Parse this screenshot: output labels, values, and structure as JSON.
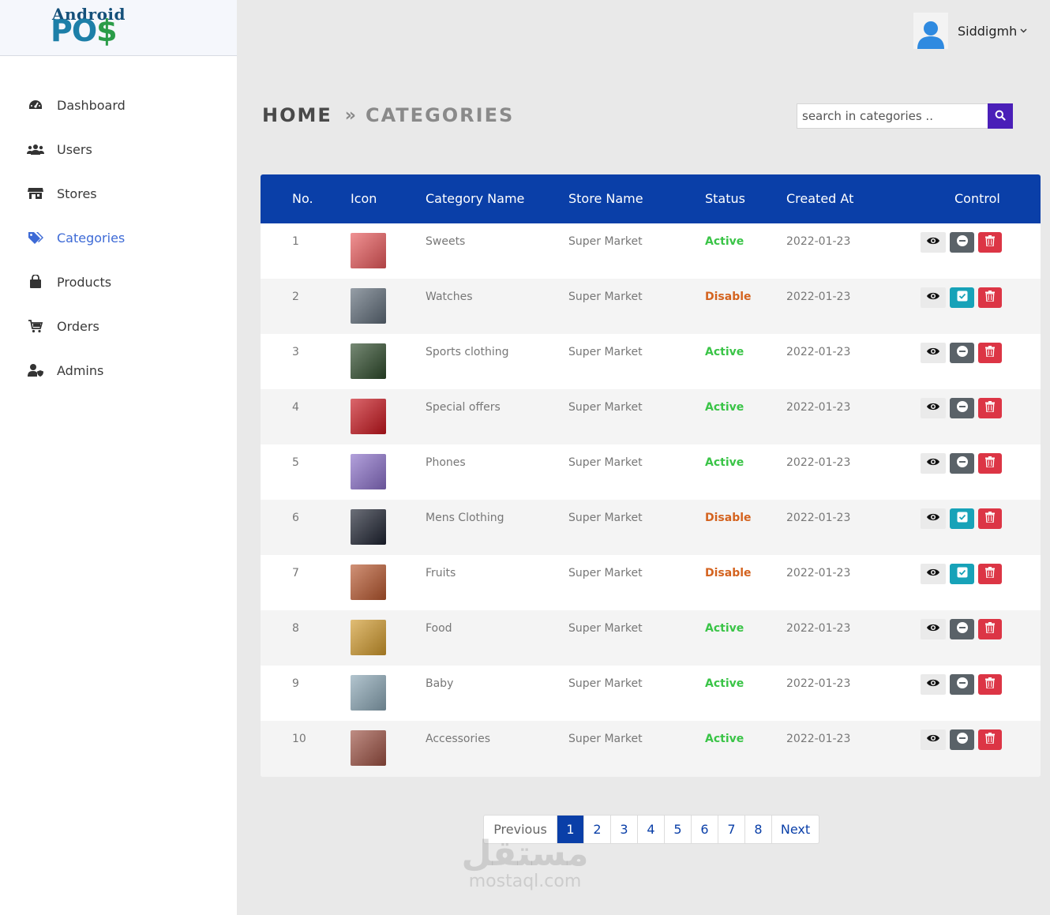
{
  "logo": {
    "top": "Android",
    "bottom_a": "PO",
    "bottom_b": "$"
  },
  "sidebar": {
    "items": [
      {
        "label": "Dashboard",
        "icon": "dashboard-icon",
        "active": false
      },
      {
        "label": "Users",
        "icon": "users-icon",
        "active": false
      },
      {
        "label": "Stores",
        "icon": "store-icon",
        "active": false
      },
      {
        "label": "Categories",
        "icon": "tags-icon",
        "active": true
      },
      {
        "label": "Products",
        "icon": "shopping-bag-icon",
        "active": false
      },
      {
        "label": "Orders",
        "icon": "cart-icon",
        "active": false
      },
      {
        "label": "Admins",
        "icon": "admin-icon",
        "active": false
      }
    ]
  },
  "header": {
    "username": "Siddigmh",
    "user_icon": "user-avatar-icon"
  },
  "breadcrumb": {
    "home": "HOME",
    "separator": "»",
    "current": "CATEGORIES"
  },
  "search": {
    "placeholder": "search in categories ..",
    "button_icon": "search-icon"
  },
  "table": {
    "columns": [
      "No.",
      "Icon",
      "Category Name",
      "Store Name",
      "Status",
      "Created At",
      "Control"
    ],
    "rows": [
      {
        "no": "1",
        "name": "Sweets",
        "store": "Super Market",
        "status": "Active",
        "created": "2022-01-23",
        "thumb": "#e8585a"
      },
      {
        "no": "2",
        "name": "Watches",
        "store": "Super Market",
        "status": "Disable",
        "created": "2022-01-23",
        "thumb": "#5e6b78"
      },
      {
        "no": "3",
        "name": "Sports clothing",
        "store": "Super Market",
        "status": "Active",
        "created": "2022-01-23",
        "thumb": "#2d4a2a"
      },
      {
        "no": "4",
        "name": "Special offers",
        "store": "Super Market",
        "status": "Active",
        "created": "2022-01-23",
        "thumb": "#c8151d"
      },
      {
        "no": "5",
        "name": "Phones",
        "store": "Super Market",
        "status": "Active",
        "created": "2022-01-23",
        "thumb": "#8a6fc9"
      },
      {
        "no": "6",
        "name": "Mens Clothing",
        "store": "Super Market",
        "status": "Disable",
        "created": "2022-01-23",
        "thumb": "#1d2230"
      },
      {
        "no": "7",
        "name": "Fruits",
        "store": "Super Market",
        "status": "Disable",
        "created": "2022-01-23",
        "thumb": "#b8572e"
      },
      {
        "no": "8",
        "name": "Food",
        "store": "Super Market",
        "status": "Active",
        "created": "2022-01-23",
        "thumb": "#d19a2c"
      },
      {
        "no": "9",
        "name": "Baby",
        "store": "Super Market",
        "status": "Active",
        "created": "2022-01-23",
        "thumb": "#8aa6b5"
      },
      {
        "no": "10",
        "name": "Accessories",
        "store": "Super Market",
        "status": "Active",
        "created": "2022-01-23",
        "thumb": "#9c5042"
      }
    ]
  },
  "pagination": {
    "previous": "Previous",
    "pages": [
      "1",
      "2",
      "3",
      "4",
      "5",
      "6",
      "7",
      "8"
    ],
    "current": "1",
    "next": "Next"
  },
  "watermark": {
    "arabic": "مستقل",
    "latin": "mostaql.com"
  },
  "colors": {
    "primary": "#0a3fa8",
    "search_button": "#4a1fb8",
    "active": "#3ac447",
    "disable": "#d4631f",
    "delete": "#dc3545",
    "enable": "#17a2b8",
    "disable_button": "#5a6268"
  }
}
